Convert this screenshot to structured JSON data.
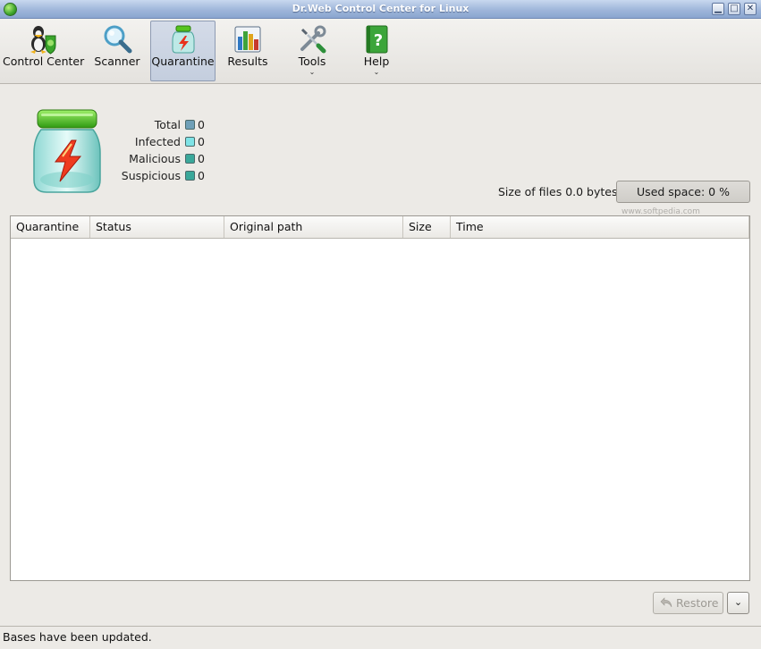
{
  "window": {
    "title": "Dr.Web Control Center for Linux",
    "icon": "drweb-spider-icon"
  },
  "window_controls": [
    {
      "name": "minimize",
      "glyph": "▁"
    },
    {
      "name": "maximize",
      "glyph": "□"
    },
    {
      "name": "close",
      "glyph": "✕"
    }
  ],
  "toolbar": {
    "items": [
      {
        "label": "Control Center",
        "icon": "control-center-icon",
        "active": false,
        "has_menu": false
      },
      {
        "label": "Scanner",
        "icon": "magnifier-icon",
        "active": false,
        "has_menu": false
      },
      {
        "label": "Quarantine",
        "icon": "quarantine-jar-icon",
        "active": true,
        "has_menu": false
      },
      {
        "label": "Results",
        "icon": "bar-chart-icon",
        "active": false,
        "has_menu": false
      },
      {
        "label": "Tools",
        "icon": "wrench-screwdriver-icon",
        "active": false,
        "has_menu": true
      },
      {
        "label": "Help",
        "icon": "help-book-icon",
        "active": false,
        "has_menu": true
      }
    ],
    "menu_arrow": "⌄"
  },
  "stats": [
    {
      "label": "Total",
      "value": "0",
      "color": "#6fa0b8"
    },
    {
      "label": "Infected",
      "value": "0",
      "color": "#7fe3e6"
    },
    {
      "label": "Malicious",
      "value": "0",
      "color": "#3aa89a"
    },
    {
      "label": "Suspicious",
      "value": "0",
      "color": "#3aa89a"
    }
  ],
  "size_info": {
    "label": "Size of files",
    "value": "0.0 bytes"
  },
  "used_space": "Used space:  0 %",
  "watermark": "www.softpedia.com",
  "table": {
    "columns": [
      "Quarantine",
      "Status",
      "Original path",
      "Size",
      "Time"
    ],
    "rows": []
  },
  "buttons": {
    "restore": "Restore",
    "dropdown": "⌄"
  },
  "status": {
    "message": "Bases have been updated."
  }
}
